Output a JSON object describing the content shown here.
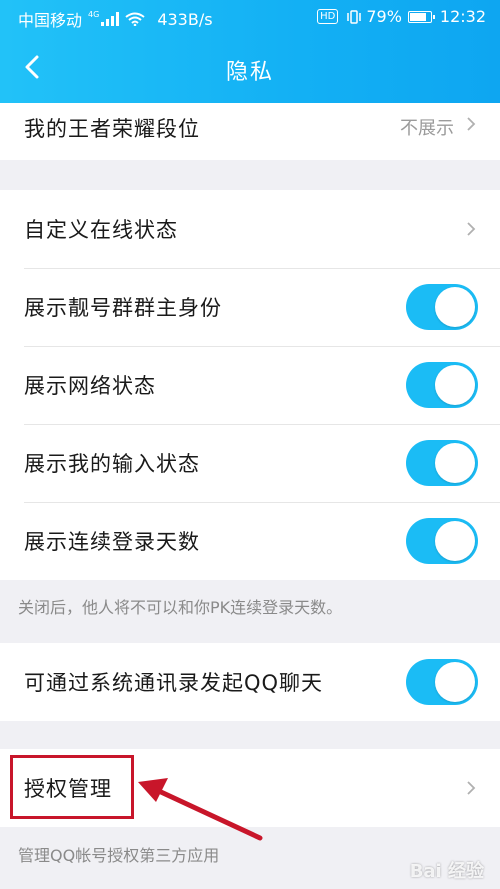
{
  "status_bar": {
    "carrier": "中国移动",
    "network": "4G",
    "speed": "433B/s",
    "hd": "HD",
    "battery": "79%",
    "time": "12:32"
  },
  "nav": {
    "title": "隐私"
  },
  "rows": {
    "honor_rank": {
      "label": "我的王者荣耀段位",
      "value": "不展示"
    },
    "online_status": {
      "label": "自定义在线状态"
    },
    "group_owner": {
      "label": "展示靓号群群主身份",
      "on": true
    },
    "network_status": {
      "label": "展示网络状态",
      "on": true
    },
    "input_status": {
      "label": "展示我的输入状态",
      "on": true
    },
    "login_days": {
      "label": "展示连续登录天数",
      "on": true
    },
    "login_days_note": "关闭后，他人将不可以和你PK连续登录天数。",
    "contacts_chat": {
      "label": "可通过系统通讯录发起QQ聊天",
      "on": true
    },
    "auth_manage": {
      "label": "授权管理"
    },
    "auth_manage_note": "管理QQ帐号授权第三方应用"
  },
  "colors": {
    "accent": "#1bbcf5",
    "header": "#13b0f4",
    "highlight": "#c8162a"
  },
  "watermark": "Bai 经验"
}
